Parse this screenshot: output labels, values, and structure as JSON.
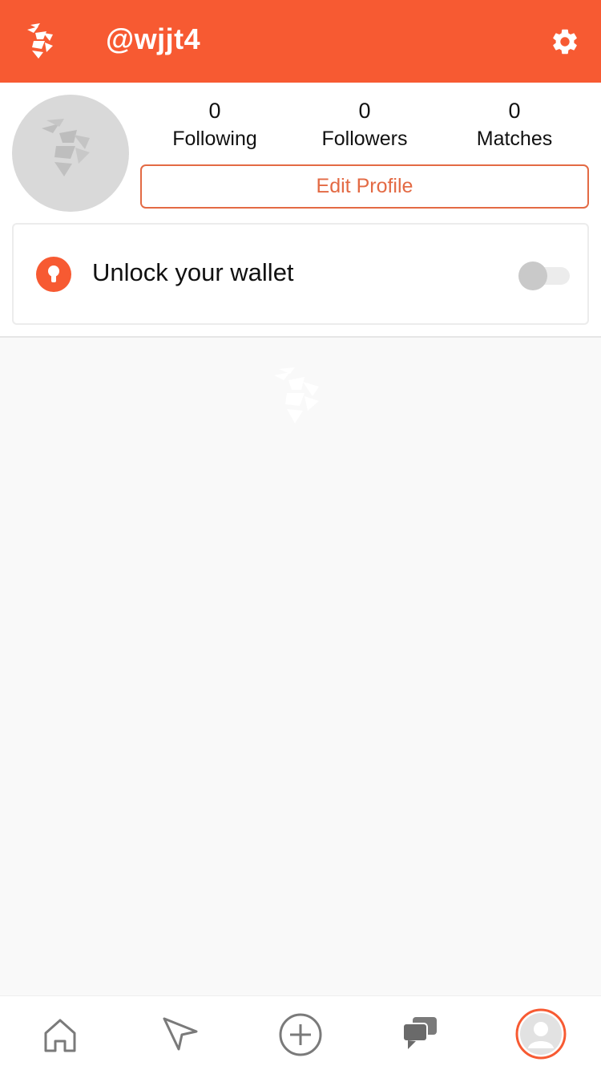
{
  "theme": {
    "accent": "#f75a32",
    "button_accent": "#e36a44"
  },
  "header": {
    "logo_icon": "hornet-logo-icon",
    "username": "@wjjt4",
    "settings_icon": "gear-icon"
  },
  "profile": {
    "avatar_icon": "hornet-avatar-placeholder",
    "stats": {
      "following": {
        "count": "0",
        "label": "Following"
      },
      "followers": {
        "count": "0",
        "label": "Followers"
      },
      "matches": {
        "count": "0",
        "label": "Matches"
      }
    },
    "edit_button_label": "Edit Profile"
  },
  "wallet": {
    "icon": "lock-icon",
    "label": "Unlock your wallet",
    "toggle_on": false
  },
  "tabbar": {
    "items": [
      {
        "name": "home",
        "icon": "home-icon"
      },
      {
        "name": "explore",
        "icon": "navigation-arrow-icon"
      },
      {
        "name": "add",
        "icon": "plus-circle-icon"
      },
      {
        "name": "messages",
        "icon": "chat-bubbles-icon"
      },
      {
        "name": "profile",
        "icon": "profile-avatar-icon",
        "active": true
      }
    ]
  }
}
